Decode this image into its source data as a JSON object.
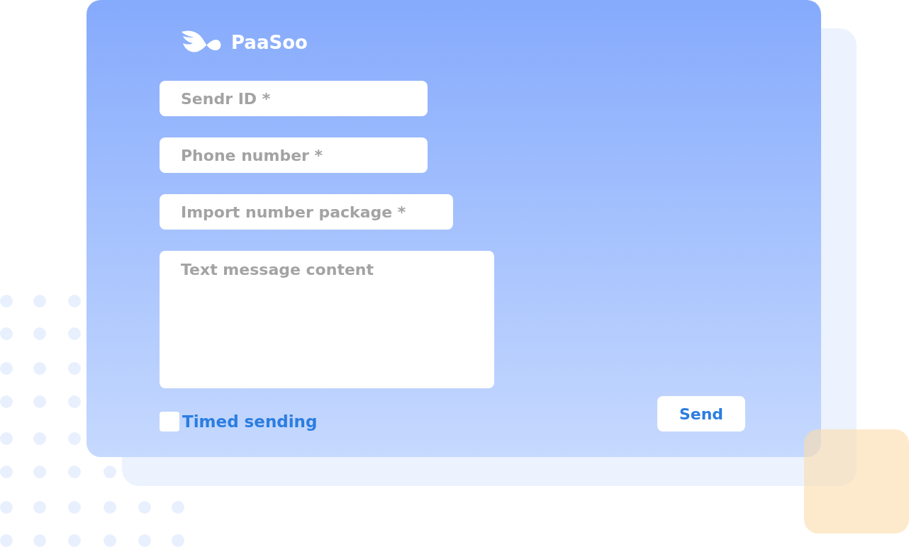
{
  "logo": {
    "text": "PaaSoo"
  },
  "fields": [
    {
      "kind": "input",
      "placeholder": "Sendr ID *"
    },
    {
      "kind": "input",
      "placeholder": "Phone number *"
    },
    {
      "kind": "input",
      "placeholder": "Import number package *"
    },
    {
      "kind": "textarea",
      "placeholder": "Text message content"
    }
  ],
  "timed_sending": {
    "label": "Timed sending",
    "checked": false
  },
  "send_button": {
    "label": "Send"
  }
}
